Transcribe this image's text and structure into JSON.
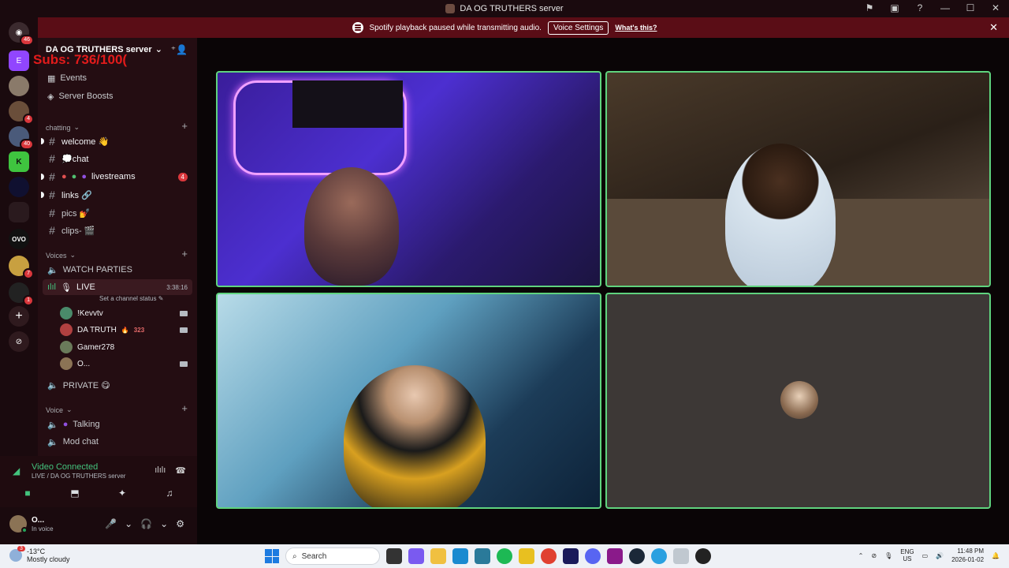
{
  "window": {
    "title": "DA OG TRUTHERS server"
  },
  "banner": {
    "message": "Spotify playback paused while transmitting audio.",
    "voice_settings_label": "Voice Settings",
    "whats_this_label": "What's this?",
    "close_glyph": "✕"
  },
  "guilds": {
    "home_badge": "46",
    "badges": [
      "4",
      "40",
      "7",
      "1"
    ]
  },
  "server": {
    "name": "DA OG TRUTHERS server",
    "overlay_text": "Subs: 736/100(",
    "events_label": "Events",
    "boosts_label": "Server Boosts"
  },
  "categories": {
    "chatting": "chatting",
    "voices": "Voices",
    "voice": "Voice"
  },
  "text_channels": [
    {
      "name": "welcome 👋"
    },
    {
      "name": "💭chat"
    },
    {
      "name": "livestreams",
      "badge": "4"
    },
    {
      "name": "links 🔗"
    },
    {
      "name": "pics 💅"
    },
    {
      "name": "clips- 🎬"
    }
  ],
  "voice_channels": {
    "watch_parties": "WATCH PARTIES",
    "live": {
      "name": "LIVE",
      "timer": "3:38:16",
      "status_placeholder": "Set a channel status"
    },
    "members": [
      {
        "name": "!Kevvtv"
      },
      {
        "name": "DA TRUTH",
        "tag": "323"
      },
      {
        "name": "Gamer278"
      },
      {
        "name": "O..."
      }
    ],
    "private": "PRIVATE 😋",
    "talking": "Talking",
    "mod_chat": "Mod chat"
  },
  "voice_connection": {
    "status": "Video Connected",
    "location": "LIVE / DA OG TRUTHERS server"
  },
  "user_panel": {
    "name": "O...",
    "status": "In voice"
  },
  "taskbar": {
    "weather_temp": "-13°C",
    "weather_desc": "Mostly cloudy",
    "weather_badge": "3",
    "search_label": "Search",
    "lang_top": "ENG",
    "lang_bottom": "US",
    "time": "11:48 PM",
    "date": "2026-01-02"
  },
  "colors": {
    "accent_green": "#5fd37e",
    "banner_bg": "#5a0d16",
    "overlay_red": "#e21b1b"
  }
}
